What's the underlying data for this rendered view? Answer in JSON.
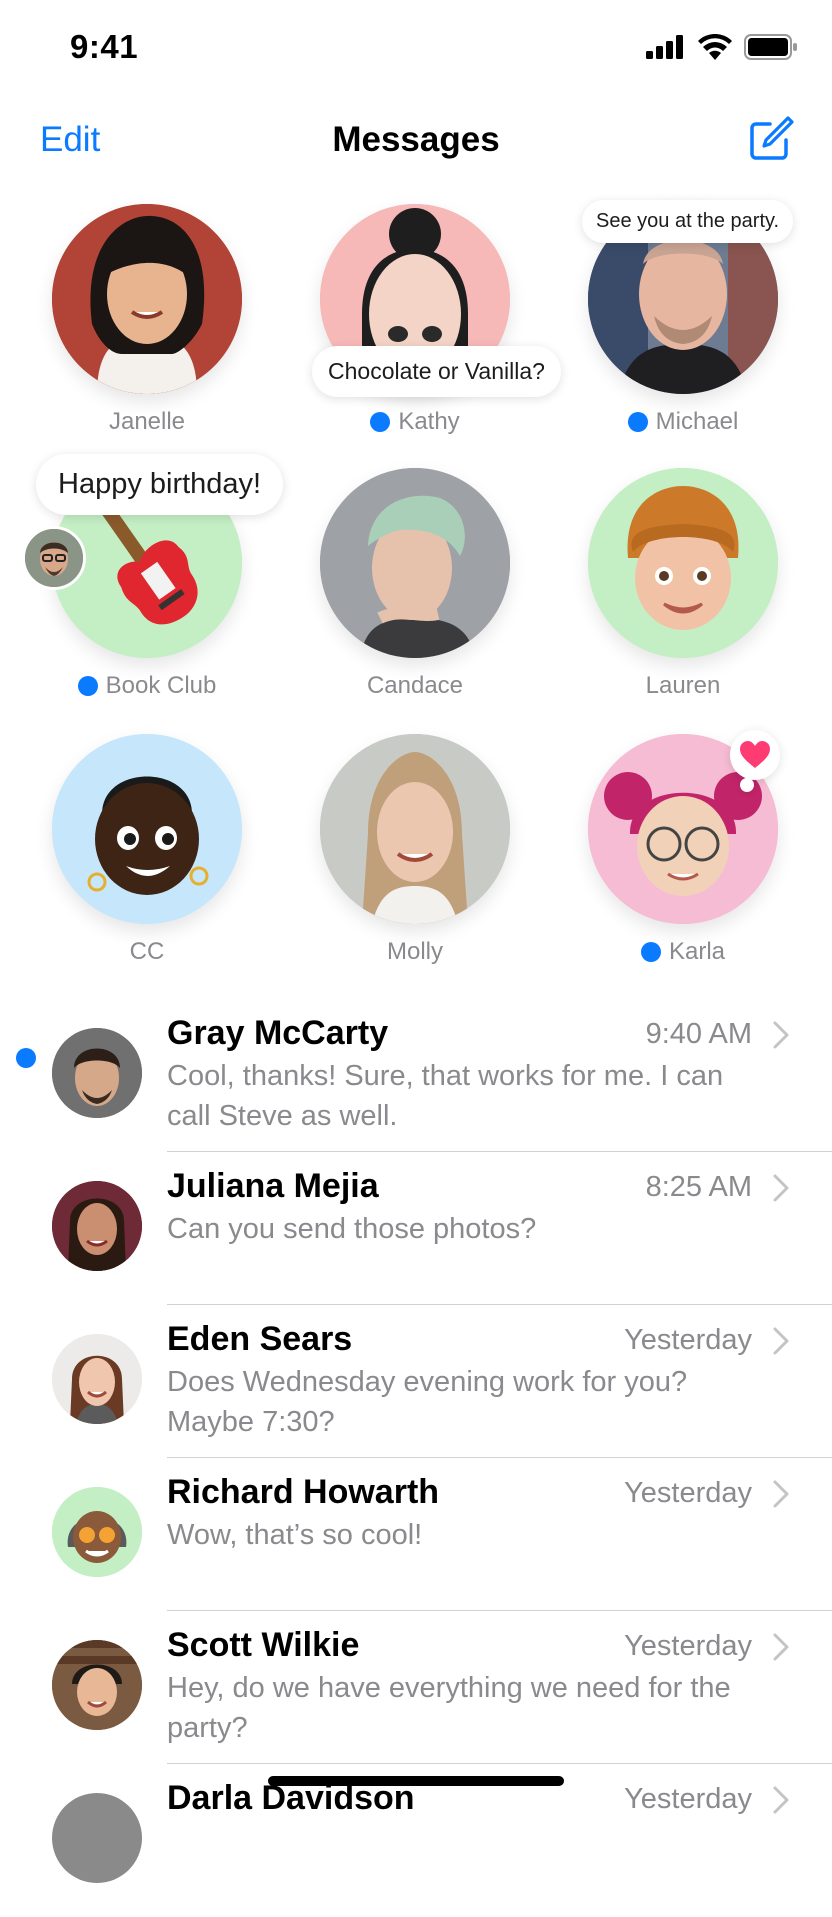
{
  "status": {
    "time": "9:41"
  },
  "nav": {
    "edit_label": "Edit",
    "title": "Messages"
  },
  "pinned": [
    {
      "name": "Janelle",
      "unread": false
    },
    {
      "name": "Kathy",
      "unread": true,
      "bubble": "Chocolate or Vanilla?"
    },
    {
      "name": "Michael",
      "unread": true,
      "bubble": "See you at the party."
    },
    {
      "name": "Book Club",
      "unread": true,
      "bubble": "Happy birthday!"
    },
    {
      "name": "Candace",
      "unread": false
    },
    {
      "name": "Lauren",
      "unread": false
    },
    {
      "name": "CC",
      "unread": false
    },
    {
      "name": "Molly",
      "unread": false
    },
    {
      "name": "Karla",
      "unread": true,
      "reaction": "heart"
    }
  ],
  "conversations": [
    {
      "name": "Gray McCarty",
      "time": "9:40 AM",
      "preview": "Cool, thanks! Sure, that works for me. I can call Steve as well.",
      "unread": true
    },
    {
      "name": "Juliana Mejia",
      "time": "8:25 AM",
      "preview": "Can you send those photos?",
      "unread": false
    },
    {
      "name": "Eden Sears",
      "time": "Yesterday",
      "preview": "Does Wednesday evening work for you? Maybe 7:30?",
      "unread": false
    },
    {
      "name": "Richard Howarth",
      "time": "Yesterday",
      "preview": "Wow, that’s so cool!",
      "unread": false
    },
    {
      "name": "Scott Wilkie",
      "time": "Yesterday",
      "preview": "Hey, do we have everything we need for the party?",
      "unread": false
    },
    {
      "name": "Darla Davidson",
      "time": "Yesterday",
      "preview": "",
      "unread": false
    }
  ],
  "colors": {
    "accent": "#0a7aff",
    "secondary_text": "#8a8a8e",
    "divider": "#d1d1d6"
  }
}
